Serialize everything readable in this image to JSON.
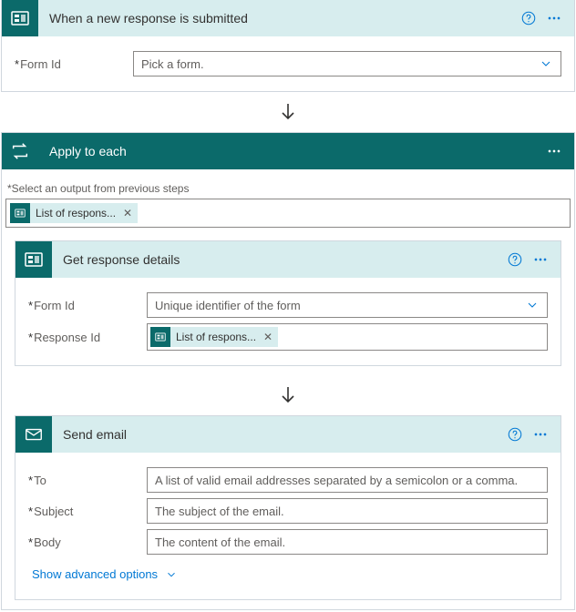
{
  "step1": {
    "title": "When a new response is submitted",
    "form_id_label": "Form Id",
    "form_id_placeholder": "Pick a form."
  },
  "foreach": {
    "title": "Apply to each",
    "hint_label": "Select an output from previous steps",
    "token_label": "List of respons..."
  },
  "step2": {
    "title": "Get response details",
    "form_id_label": "Form Id",
    "form_id_placeholder": "Unique identifier of the form",
    "response_id_label": "Response Id",
    "response_token": "List of respons..."
  },
  "step3": {
    "title": "Send email",
    "to_label": "To",
    "to_placeholder": "A list of valid email addresses separated by a semicolon or a comma.",
    "subject_label": "Subject",
    "subject_placeholder": "The subject of the email.",
    "body_label": "Body",
    "body_placeholder": "The content of the email.",
    "show_advanced": "Show advanced options"
  }
}
